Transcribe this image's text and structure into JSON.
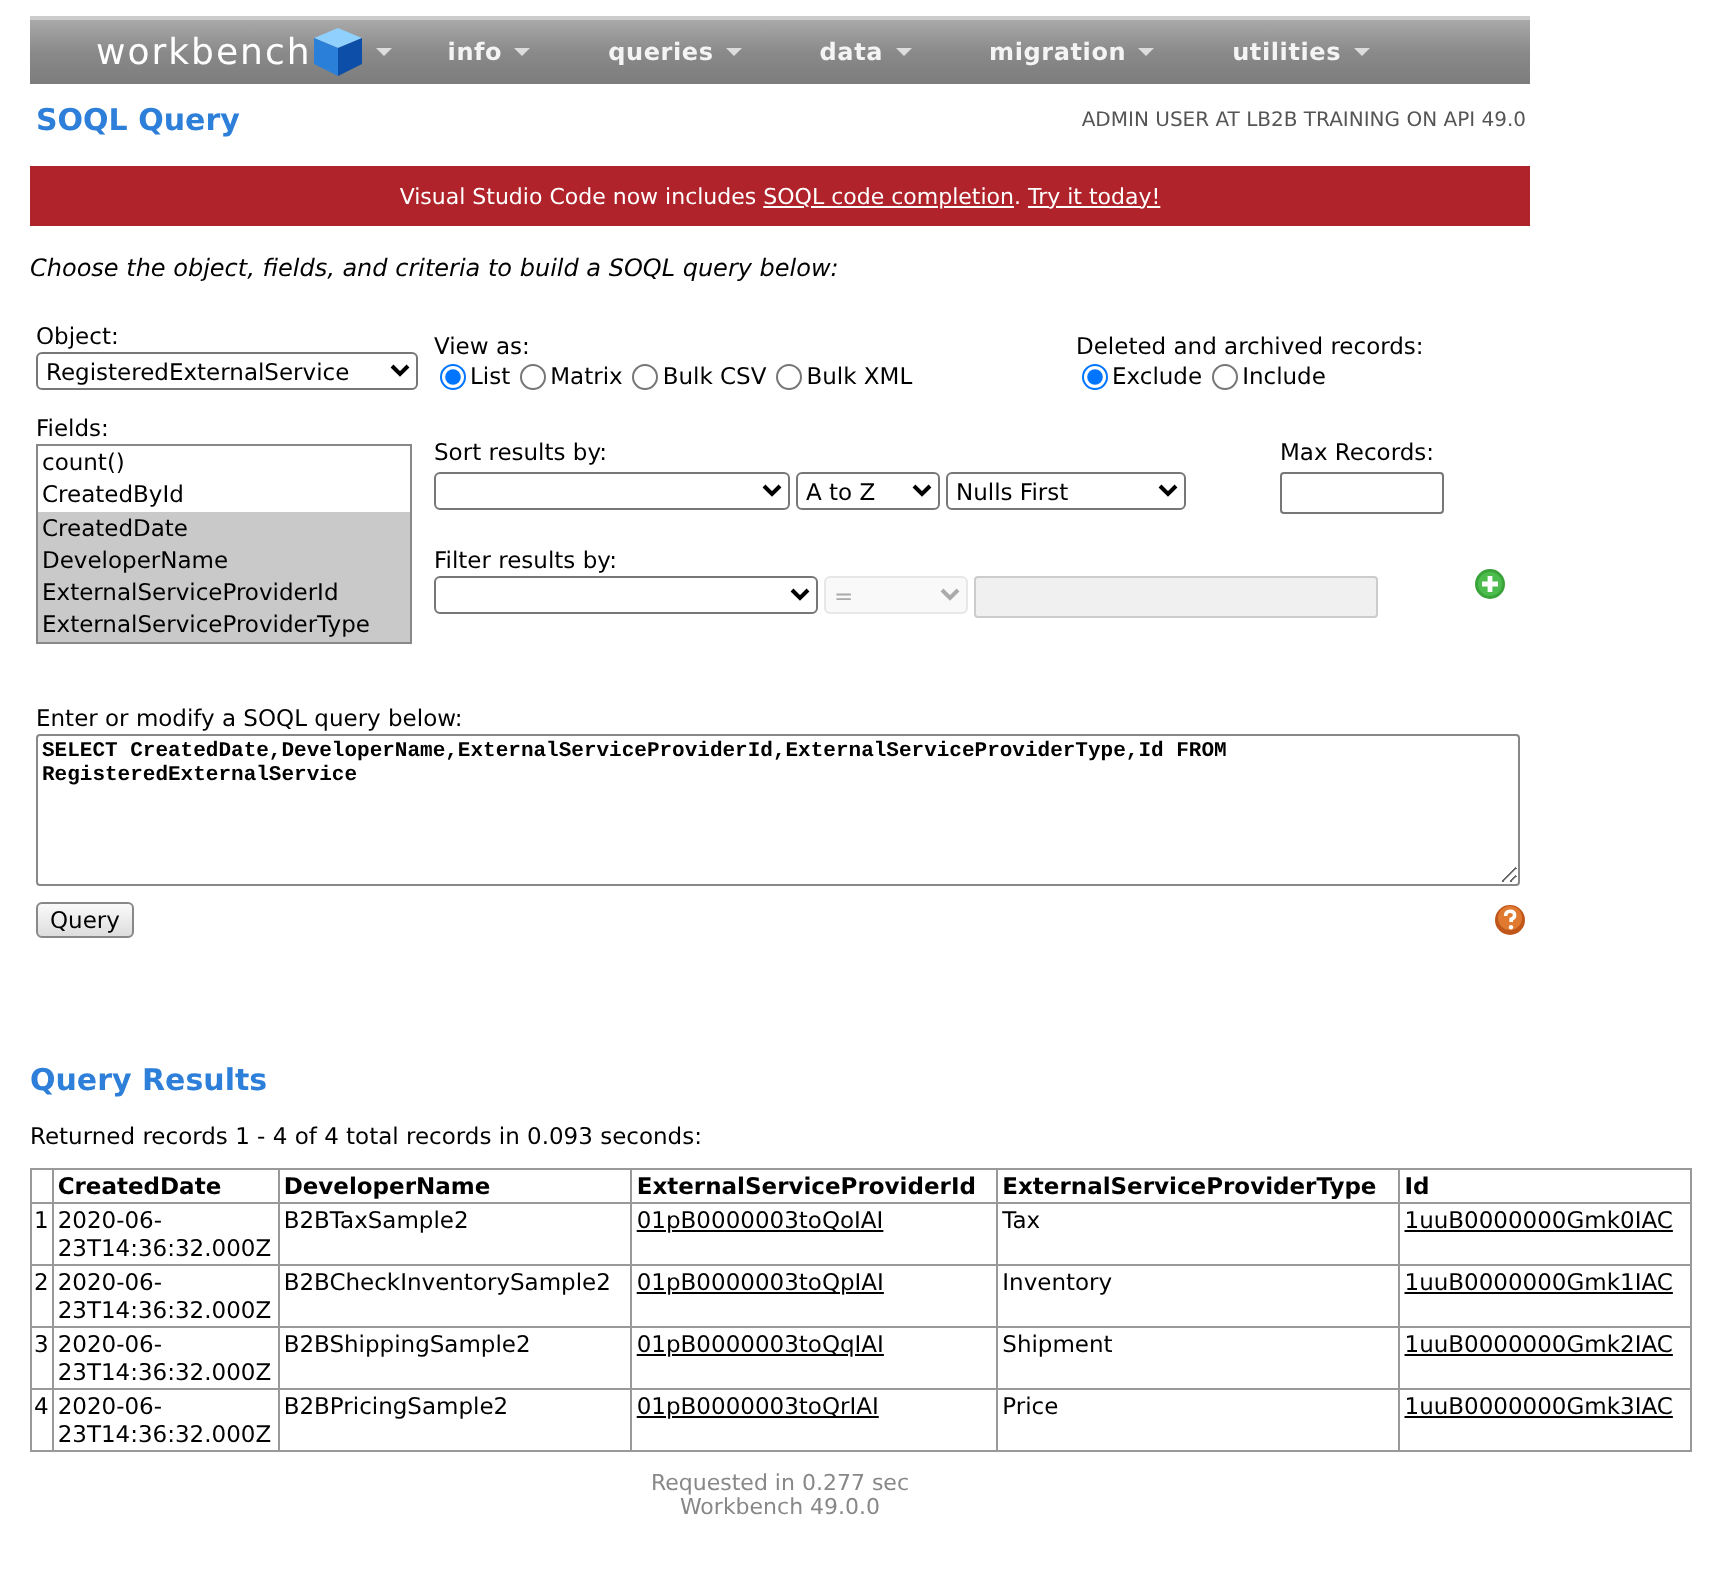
{
  "navbar": {
    "logo": "workbench",
    "menus": [
      {
        "label": "info"
      },
      {
        "label": "queries"
      },
      {
        "label": "data"
      },
      {
        "label": "migration"
      },
      {
        "label": "utilities"
      }
    ]
  },
  "header": {
    "title": "SOQL Query",
    "user_info": "ADMIN USER AT LB2B TRAINING ON API 49.0"
  },
  "banner": {
    "parts": [
      {
        "kind": "text",
        "text": "Visual Studio Code now includes "
      },
      {
        "kind": "link",
        "text": "SOQL code completion"
      },
      {
        "kind": "link",
        "prefix": ". ",
        "text": "Try it today!"
      }
    ]
  },
  "instructions": "Choose the object, fields, and criteria to build a SOQL query below:",
  "object": {
    "label": "Object:",
    "value": "RegisteredExternalService"
  },
  "view_as": {
    "label": "View as:",
    "options": [
      {
        "label": "List",
        "selected": true
      },
      {
        "label": "Matrix",
        "selected": false
      },
      {
        "label": "Bulk CSV",
        "selected": false
      },
      {
        "label": "Bulk XML",
        "selected": false
      }
    ]
  },
  "deleted_records": {
    "label": "Deleted and archived records:",
    "options": [
      {
        "label": "Exclude",
        "selected": true
      },
      {
        "label": "Include",
        "selected": false
      }
    ]
  },
  "fields": {
    "label": "Fields:",
    "items": [
      {
        "label": "count()",
        "selected": false
      },
      {
        "label": "CreatedById",
        "selected": false
      },
      {
        "label": "CreatedDate",
        "selected": true
      },
      {
        "label": "DeveloperName",
        "selected": true
      },
      {
        "label": "ExternalServiceProviderId",
        "selected": true
      },
      {
        "label": "ExternalServiceProviderType",
        "selected": true
      }
    ]
  },
  "sort": {
    "label": "Sort results by:",
    "direction": "A to Z",
    "nulls": "Nulls First"
  },
  "max_records": {
    "label": "Max Records:"
  },
  "filter": {
    "label": "Filter results by:",
    "operator": "=",
    "operator_disabled": true,
    "value_disabled": true
  },
  "query_editor": {
    "label": "Enter or modify a SOQL query below:",
    "value": "SELECT CreatedDate,DeveloperName,ExternalServiceProviderId,ExternalServiceProviderType,Id FROM RegisteredExternalService"
  },
  "query_button": "Query",
  "results": {
    "title": "Query Results",
    "summary": "Returned records 1 - 4 of 4 total records in 0.093 seconds:",
    "table": {
      "columns": [
        {
          "label": "CreatedDate",
          "kind": "text"
        },
        {
          "label": "DeveloperName",
          "kind": "text"
        },
        {
          "label": "ExternalServiceProviderId",
          "kind": "link"
        },
        {
          "label": "ExternalServiceProviderType",
          "kind": "text"
        },
        {
          "label": "Id",
          "kind": "link"
        }
      ],
      "rows": [
        {
          "number": "1",
          "cells": [
            "2020-06-23T14:36:32.000Z",
            "B2BTaxSample2",
            "01pB0000003toQoIAI",
            "Tax",
            "1uuB0000000Gmk0IAC"
          ]
        },
        {
          "number": "2",
          "cells": [
            "2020-06-23T14:36:32.000Z",
            "B2BCheckInventorySample2",
            "01pB0000003toQpIAI",
            "Inventory",
            "1uuB0000000Gmk1IAC"
          ]
        },
        {
          "number": "3",
          "cells": [
            "2020-06-23T14:36:32.000Z",
            "B2BShippingSample2",
            "01pB0000003toQqIAI",
            "Shipment",
            "1uuB0000000Gmk2IAC"
          ]
        },
        {
          "number": "4",
          "cells": [
            "2020-06-23T14:36:32.000Z",
            "B2BPricingSample2",
            "01pB0000003toQrIAI",
            "Price",
            "1uuB0000000Gmk3IAC"
          ]
        }
      ]
    }
  },
  "footer": {
    "lines": [
      "Requested in 0.277 sec",
      "Workbench 49.0.0"
    ]
  }
}
